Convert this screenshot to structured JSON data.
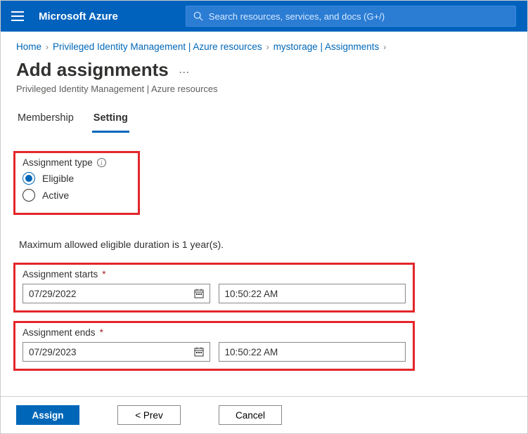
{
  "header": {
    "brand": "Microsoft Azure",
    "search_placeholder": "Search resources, services, and docs (G+/)"
  },
  "breadcrumb": {
    "items": [
      "Home",
      "Privileged Identity Management | Azure resources",
      "mystorage | Assignments"
    ]
  },
  "page": {
    "title": "Add assignments",
    "subtitle": "Privileged Identity Management | Azure resources"
  },
  "tabs": {
    "items": [
      "Membership",
      "Setting"
    ],
    "active_index": 1
  },
  "assignment_type": {
    "label": "Assignment type",
    "options": [
      "Eligible",
      "Active"
    ],
    "selected_index": 0
  },
  "note": "Maximum allowed eligible duration is 1 year(s).",
  "start": {
    "label": "Assignment starts",
    "date": "07/29/2022",
    "time": "10:50:22 AM"
  },
  "end": {
    "label": "Assignment ends",
    "date": "07/29/2023",
    "time": "10:50:22 AM"
  },
  "actions": {
    "assign": "Assign",
    "prev": "<  Prev",
    "cancel": "Cancel"
  }
}
